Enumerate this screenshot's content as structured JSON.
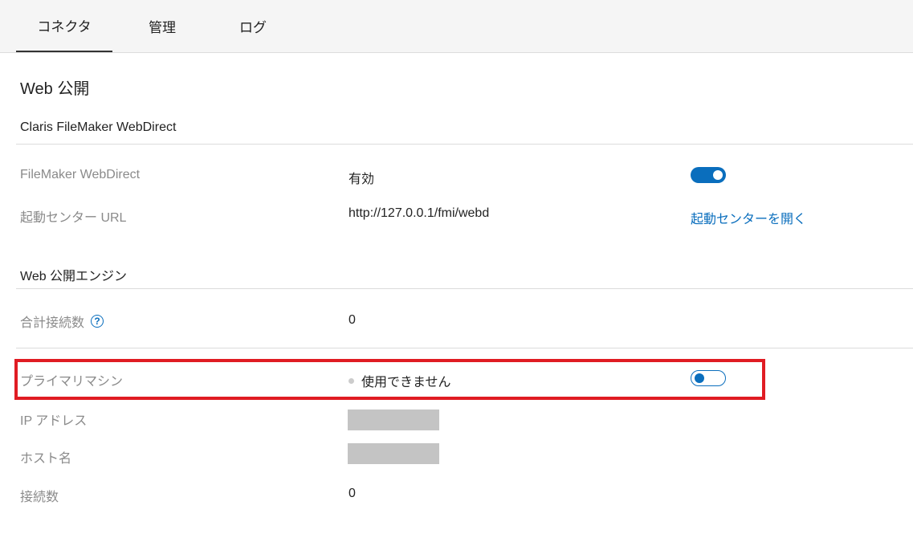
{
  "tabs": [
    {
      "label": "コネクタ",
      "active": true
    },
    {
      "label": "管理",
      "active": false
    },
    {
      "label": "ログ",
      "active": false
    }
  ],
  "page_title": "Web 公開",
  "webdirect_section": {
    "heading": "Claris FileMaker WebDirect",
    "rows": {
      "webdirect": {
        "label": "FileMaker WebDirect",
        "value": "有効",
        "toggle": "on"
      },
      "launch_center": {
        "label": "起動センター URL",
        "value": "http://127.0.0.1/fmi/webd",
        "link": "起動センターを開く"
      }
    }
  },
  "engine_section": {
    "heading": "Web 公開エンジン",
    "rows": {
      "total_connections": {
        "label": "合計接続数",
        "help_icon": "?",
        "value": "0"
      },
      "primary_machine": {
        "label": "プライマリマシン",
        "value": "使用できません",
        "toggle": "off"
      },
      "ip_address": {
        "label": "IP アドレス",
        "value_redacted": true
      },
      "host_name": {
        "label": "ホスト名",
        "value_redacted": true
      },
      "connections": {
        "label": "接続数",
        "value": "0"
      }
    }
  },
  "colors": {
    "accent": "#0a6ebd",
    "highlight_box": "#e01c23",
    "status_dot": "#cccccc"
  }
}
